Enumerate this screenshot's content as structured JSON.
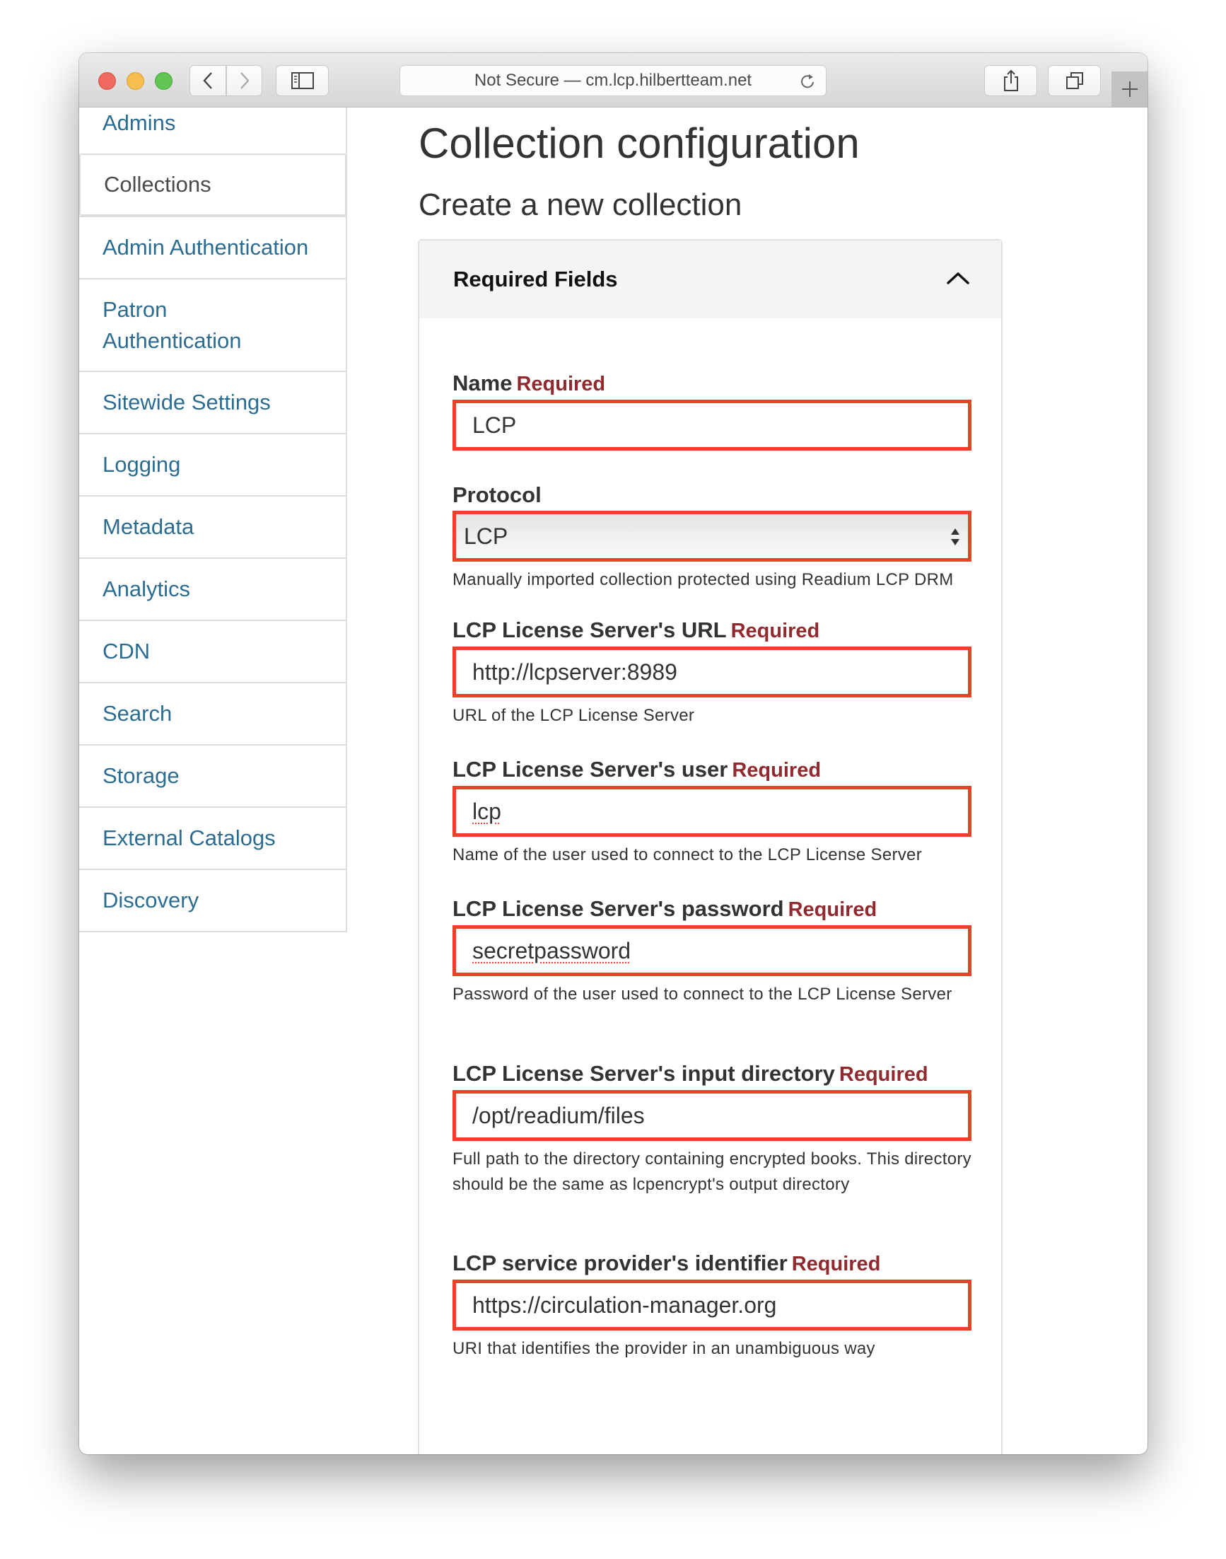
{
  "browser": {
    "url_text": "Not Secure — cm.lcp.hilbertteam.net",
    "icons": {
      "back": "chevron-left-icon",
      "forward": "chevron-right-icon",
      "sidebar": "sidebar-icon",
      "reload": "reload-icon",
      "share": "share-icon",
      "tabs": "tabs-overview-icon",
      "new_tab": "plus-icon"
    }
  },
  "sidebar": {
    "items": [
      {
        "label": "Admins",
        "active": false
      },
      {
        "label": "Collections",
        "active": true
      },
      {
        "label": "Admin Authentication",
        "active": false
      },
      {
        "label": "Patron Authentication",
        "active": false
      },
      {
        "label": "Sitewide Settings",
        "active": false
      },
      {
        "label": "Logging",
        "active": false
      },
      {
        "label": "Metadata",
        "active": false
      },
      {
        "label": "Analytics",
        "active": false
      },
      {
        "label": "CDN",
        "active": false
      },
      {
        "label": "Search",
        "active": false
      },
      {
        "label": "Storage",
        "active": false
      },
      {
        "label": "External Catalogs",
        "active": false
      },
      {
        "label": "Discovery",
        "active": false
      }
    ],
    "colors": {
      "link": "#2d6c91",
      "active": "#4a4a4a"
    }
  },
  "main": {
    "title": "Collection configuration",
    "subtitle": "Create a new collection",
    "panel": {
      "header": "Required Fields",
      "expanded": true,
      "required_text": "Required",
      "fields": [
        {
          "label": "Name",
          "required": true,
          "type": "text",
          "value": "LCP",
          "help": ""
        },
        {
          "label": "Protocol",
          "required": false,
          "type": "select",
          "value": "LCP",
          "help": "Manually imported collection protected using Readium LCP DRM"
        },
        {
          "label": "LCP License Server's URL",
          "required": true,
          "type": "text",
          "value": "http://lcpserver:8989",
          "help": "URL of the LCP License Server"
        },
        {
          "label": "LCP License Server's user",
          "required": true,
          "type": "text",
          "value": "lcp",
          "help": "Name of the user used to connect to the LCP License Server"
        },
        {
          "label": "LCP License Server's password",
          "required": true,
          "type": "text",
          "value": "secretpassword",
          "help": "Password of the user used to connect to the LCP License Server"
        },
        {
          "label": "LCP License Server's input directory",
          "required": true,
          "type": "text",
          "value": "/opt/readium/files",
          "help": "Full path to the directory containing encrypted books. This directory should be the same as lcpencrypt's output directory"
        },
        {
          "label": "LCP service provider's identifier",
          "required": true,
          "type": "text",
          "value": "https://circulation-manager.org",
          "help": "URI that identifies the provider in an unambiguous way"
        }
      ]
    },
    "colors": {
      "highlight_border": "#e8432a",
      "required": "#912a2e"
    }
  }
}
